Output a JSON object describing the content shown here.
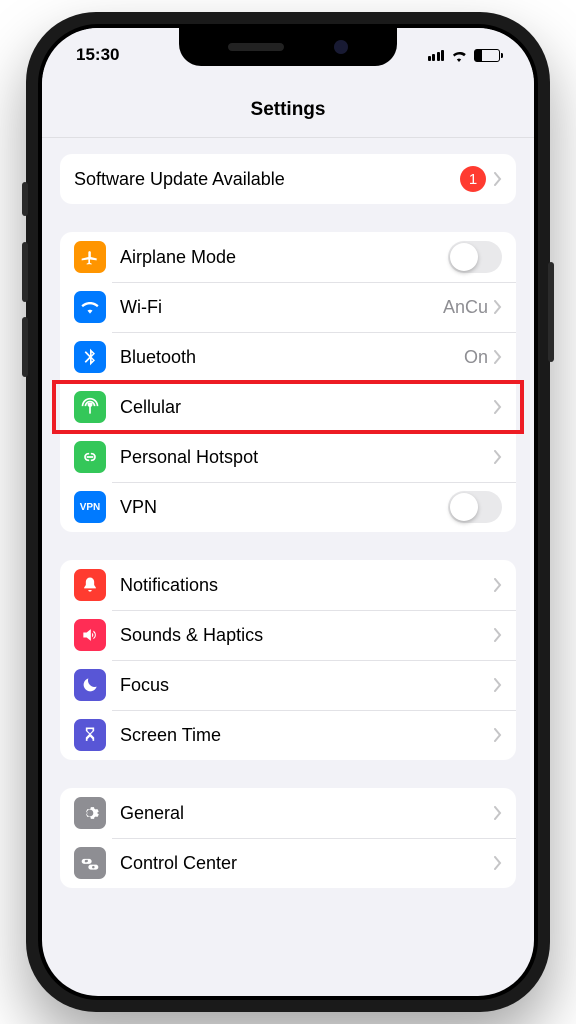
{
  "statusbar": {
    "time": "15:30",
    "battery_level_pct": 30
  },
  "header": {
    "title": "Settings"
  },
  "groups": [
    {
      "kind": "update",
      "items": [
        {
          "id": "software-update",
          "label": "Software Update Available",
          "badge": "1",
          "chevron": true
        }
      ]
    },
    {
      "kind": "connectivity",
      "items": [
        {
          "id": "airplane",
          "label": "Airplane Mode",
          "icon": "airplane",
          "icon_bg": "#ff9500",
          "toggle": false
        },
        {
          "id": "wifi",
          "label": "Wi-Fi",
          "icon": "wifi",
          "icon_bg": "#007aff",
          "value": "AnCu",
          "chevron": true
        },
        {
          "id": "bluetooth",
          "label": "Bluetooth",
          "icon": "bluetooth",
          "icon_bg": "#007aff",
          "value": "On",
          "chevron": true
        },
        {
          "id": "cellular",
          "label": "Cellular",
          "icon": "antenna",
          "icon_bg": "#34c759",
          "chevron": true,
          "highlighted": true
        },
        {
          "id": "hotspot",
          "label": "Personal Hotspot",
          "icon": "link",
          "icon_bg": "#34c759",
          "chevron": true
        },
        {
          "id": "vpn",
          "label": "VPN",
          "icon": "vpn-text",
          "icon_bg": "#007aff",
          "toggle": false
        }
      ]
    },
    {
      "kind": "notifications",
      "items": [
        {
          "id": "notifications",
          "label": "Notifications",
          "icon": "bell",
          "icon_bg": "#ff3b30",
          "chevron": true
        },
        {
          "id": "sounds",
          "label": "Sounds & Haptics",
          "icon": "speaker",
          "icon_bg": "#ff2d55",
          "chevron": true
        },
        {
          "id": "focus",
          "label": "Focus",
          "icon": "moon",
          "icon_bg": "#5856d6",
          "chevron": true
        },
        {
          "id": "screentime",
          "label": "Screen Time",
          "icon": "hourglass",
          "icon_bg": "#5856d6",
          "chevron": true
        }
      ]
    },
    {
      "kind": "system",
      "items": [
        {
          "id": "general",
          "label": "General",
          "icon": "gear",
          "icon_bg": "#8e8e93",
          "chevron": true
        },
        {
          "id": "controlcenter",
          "label": "Control Center",
          "icon": "switches",
          "icon_bg": "#8e8e93",
          "chevron": true
        }
      ]
    }
  ]
}
